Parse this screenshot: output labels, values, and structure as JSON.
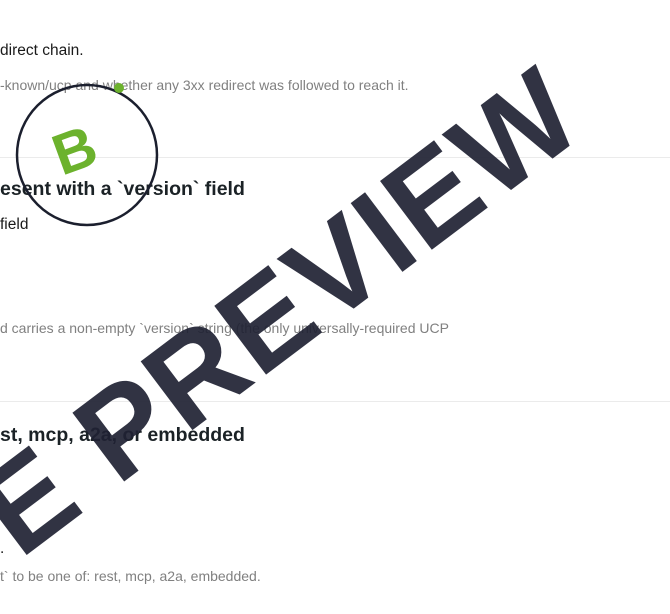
{
  "section1": {
    "summary": "direct chain.",
    "detail": "-known/ucp and whether any 3xx redirect was followed to reach it."
  },
  "section2": {
    "title": "esent with a `version` field",
    "subtitle": "field",
    "detail": "d carries a non-empty `version` string (the only universally-required UCP"
  },
  "section3": {
    "title": "st, mcp, a2a, or embedded",
    "summary": ".",
    "detail": "t` to be one of: rest, mcp, a2a, embedded."
  },
  "badge": {
    "letter": "B",
    "accent_color": "#6cb22d"
  },
  "watermark": {
    "text": "E PREVIEW"
  }
}
